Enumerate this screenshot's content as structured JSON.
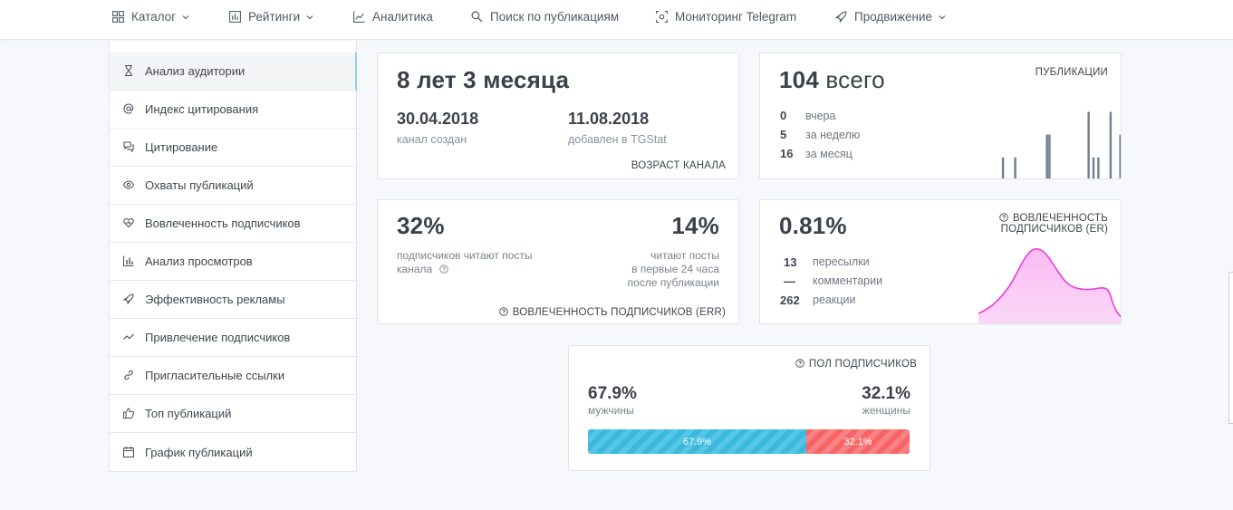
{
  "nav": {
    "items": [
      {
        "label": "Каталог",
        "icon": "grid-icon",
        "dropdown": true
      },
      {
        "label": "Рейтинги",
        "icon": "ratings-icon",
        "dropdown": true
      },
      {
        "label": "Аналитика",
        "icon": "analytics-icon",
        "dropdown": false
      },
      {
        "label": "Поиск по публикациям",
        "icon": "search-icon",
        "dropdown": false
      },
      {
        "label": "Мониторинг Telegram",
        "icon": "monitoring-icon",
        "dropdown": false
      },
      {
        "label": "Продвижение",
        "icon": "rocket-icon",
        "dropdown": true
      }
    ]
  },
  "sidebar": {
    "items": [
      {
        "label": "Анализ аудитории",
        "icon": "hourglass-icon",
        "active": true
      },
      {
        "label": "Индекс цитирования",
        "icon": "at-icon",
        "active": false
      },
      {
        "label": "Цитирование",
        "icon": "quote-icon",
        "active": false
      },
      {
        "label": "Охваты публикаций",
        "icon": "eye-icon",
        "active": false
      },
      {
        "label": "Вовлеченность подписчиков",
        "icon": "engagement-icon",
        "active": false
      },
      {
        "label": "Анализ просмотров",
        "icon": "bar-chart-icon",
        "active": false
      },
      {
        "label": "Эффективность рекламы",
        "icon": "rocket-icon",
        "active": false
      },
      {
        "label": "Привлечение подписчиков",
        "icon": "trend-icon",
        "active": false
      },
      {
        "label": "Пригласительные ссылки",
        "icon": "link-icon",
        "active": false
      },
      {
        "label": "Топ публикаций",
        "icon": "thumbs-up-icon",
        "active": false
      },
      {
        "label": "График публикаций",
        "icon": "calendar-icon",
        "active": false
      }
    ]
  },
  "age_card": {
    "headline": "8 лет 3 месяца",
    "created_date": "30.04.2018",
    "created_label": "канал создан",
    "added_date": "11.08.2018",
    "added_label": "добавлен в TGStat",
    "footer": "ВОЗРАСТ КАНАЛА"
  },
  "posts_card": {
    "total_num": "104",
    "total_word": "всего",
    "title": "ПУБЛИКАЦИИ",
    "rows": [
      {
        "value": "0",
        "label": "вчера"
      },
      {
        "value": "5",
        "label": "за неделю"
      },
      {
        "value": "16",
        "label": "за месяц"
      }
    ],
    "bar_color": "#6f7d8c",
    "bars": [
      0,
      0,
      0,
      0,
      0,
      0,
      0,
      0.3,
      0,
      0,
      0,
      0,
      0.3,
      0,
      0,
      0,
      0,
      0,
      0,
      0,
      0,
      0,
      0,
      0,
      0,
      0.6,
      0.6,
      0,
      0,
      0,
      0,
      0,
      0,
      0,
      0,
      0,
      0,
      0,
      0,
      0,
      0,
      0,
      0.9,
      0,
      0.3,
      0,
      0.3,
      0,
      0,
      0,
      0,
      0.9,
      0,
      0,
      0,
      0.6
    ]
  },
  "err_card": {
    "left_value": "32%",
    "left_label_1": "подписчиков читают посты",
    "left_label_2": "канала",
    "right_value": "14%",
    "right_label_1": "читают посты",
    "right_label_2": "в первые 24 часа",
    "right_label_3": "после публикации",
    "footer": "ВОВЛЕЧЕННОСТЬ ПОДПИСЧИКОВ (ERR)"
  },
  "er_card": {
    "value": "0.81%",
    "title_1": "ВОВЛЕЧЕННОСТЬ",
    "title_2": "ПОДПИСЧИКОВ (ER)",
    "rows": [
      {
        "value": "13",
        "label": "пересылки"
      },
      {
        "value": "—",
        "label": "комментарии"
      },
      {
        "value": "262",
        "label": "реакции"
      }
    ],
    "curve_color": "#e83fd8",
    "fill_color": "#f9b8f1"
  },
  "gender_card": {
    "title": "ПОЛ ПОДПИСЧИКОВ",
    "male_value": "67.9%",
    "male_label": "мужчины",
    "female_value": "32.1%",
    "female_label": "женщины",
    "male_fraction": 0.679,
    "female_fraction": 0.321,
    "male_bar_label": "67.9%",
    "female_bar_label": "32.1%",
    "male_color": "#3bb8dc",
    "female_color": "#f86466"
  }
}
